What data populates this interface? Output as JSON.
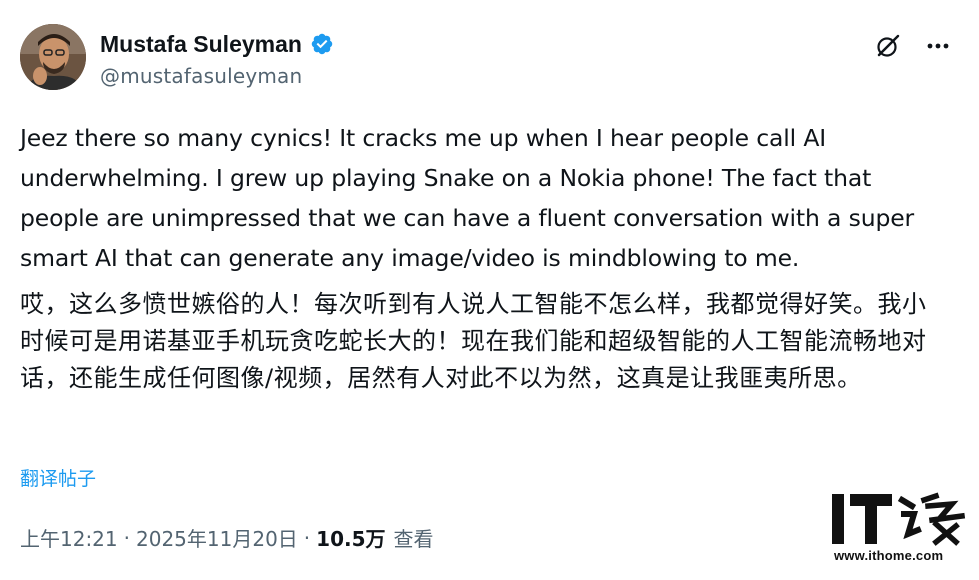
{
  "author": {
    "display_name": "Mustafa Suleyman",
    "handle": "@mustafasuleyman",
    "verified": true,
    "verified_color": "#1d9bf0"
  },
  "actions": {
    "grok_icon": "grok-icon",
    "more_icon": "more-icon"
  },
  "tweet": {
    "text_en": "Jeez there so many cynics! It cracks me up when I hear people call AI underwhelming. I grew up playing Snake on a Nokia phone! The fact that people are unimpressed that we can have a fluent conversation with a super smart AI that can generate any image/video is mindblowing to me.",
    "text_zh": "哎，这么多愤世嫉俗的人！每次听到有人说人工智能不怎么样，我都觉得好笑。我小时候可是用诺基亚手机玩贪吃蛇长大的！现在我们能和超级智能的人工智能流畅地对话，还能生成任何图像/视频，居然有人对此不以为然，这真是让我匪夷所思。",
    "translate_label": "翻译帖子"
  },
  "meta": {
    "time": "上午12:21",
    "separator": "·",
    "date": "2025年11月20日",
    "views_count": "10.5万",
    "views_label": "查看"
  },
  "watermark": {
    "logo_text": "IT之家",
    "url": "www.ithome.com"
  },
  "colors": {
    "text_primary": "#0f1419",
    "text_secondary": "#536471",
    "link": "#1d9bf0"
  }
}
